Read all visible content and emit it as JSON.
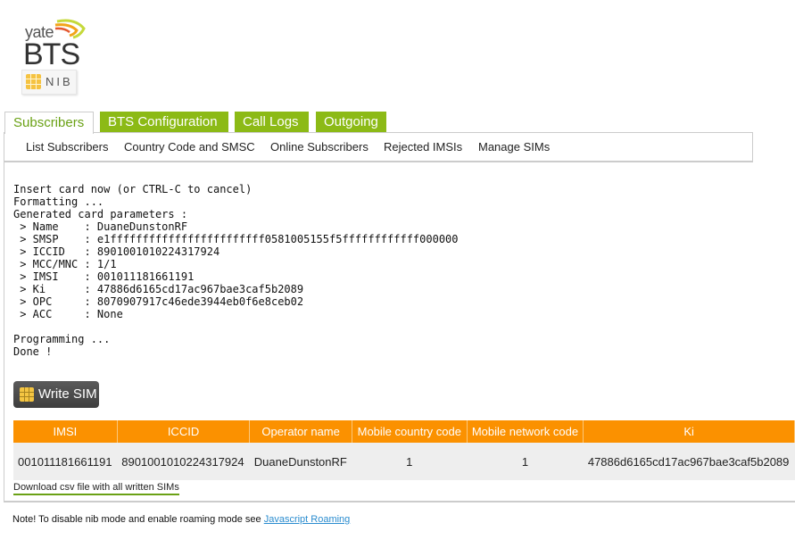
{
  "logo": {
    "top_text": "yate",
    "main_text": "BTS",
    "badge_text": "NIB"
  },
  "tabs": [
    {
      "label": "Subscribers",
      "active": true
    },
    {
      "label": "BTS Configuration",
      "active": false
    },
    {
      "label": "Call Logs",
      "active": false
    },
    {
      "label": "Outgoing",
      "active": false
    }
  ],
  "submenu": [
    {
      "label": "List Subscribers"
    },
    {
      "label": "Country Code and SMSC"
    },
    {
      "label": "Online Subscribers"
    },
    {
      "label": "Rejected IMSIs"
    },
    {
      "label": "Manage SIMs"
    }
  ],
  "console_output": "Insert card now (or CTRL-C to cancel)\nFormatting ...\nGenerated card parameters :\n > Name    : DuaneDunstonRF\n > SMSP    : e1ffffffffffffffffffffffff0581005155f5ffffffffffff000000\n > ICCID   : 8901001010224317924\n > MCC/MNC : 1/1\n > IMSI    : 001011181661191\n > Ki      : 47886d6165cd17ac967bae3caf5b2089\n > OPC     : 8070907917c46ede3944eb0f6e8ceb02\n > ACC     : None\n\nProgramming ...\nDone !",
  "write_sim_button": {
    "label": "Write SIM",
    "icon": "sim-card-icon"
  },
  "table": {
    "headers": [
      "IMSI",
      "ICCID",
      "Operator name",
      "Mobile country code",
      "Mobile network code",
      "Ki"
    ],
    "rows": [
      [
        "001011181661191",
        "8901001010224317924",
        "DuaneDunstonRF",
        "1",
        "1",
        "47886d6165cd17ac967bae3caf5b2089"
      ]
    ]
  },
  "csv_link": "Download csv file with all written SIMs",
  "note": {
    "text": "Note! To disable nib mode and enable roaming mode see ",
    "link": "Javascript Roaming"
  },
  "colors": {
    "tab_green": "#8cba16",
    "active_tab_text": "#6aa115",
    "table_header_orange": "#fb9100",
    "link_blue": "#2a8ccf"
  }
}
